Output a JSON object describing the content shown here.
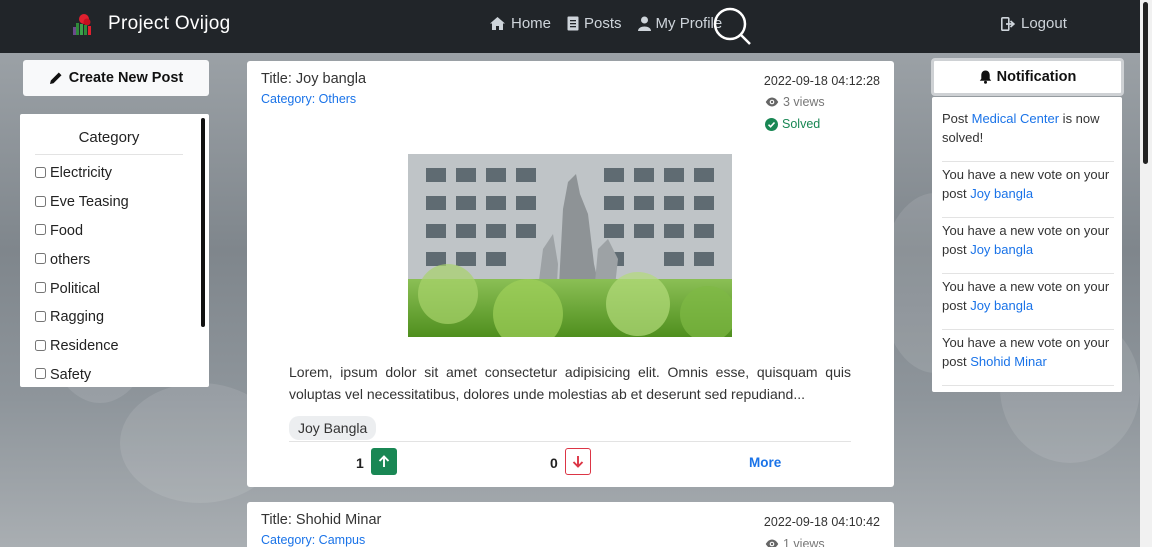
{
  "navbar": {
    "brand": "Project Ovijog",
    "links": [
      {
        "label": "Home",
        "icon": "home-icon"
      },
      {
        "label": "Posts",
        "icon": "file-icon"
      },
      {
        "label": "My Profile",
        "icon": "user-icon"
      }
    ],
    "search_icon": "search-icon",
    "logout": "Logout"
  },
  "sidebar": {
    "create_post": "Create New Post",
    "category_title": "Category",
    "categories": [
      "Electricity",
      "Eve Teasing",
      "Food",
      "others",
      "Political",
      "Ragging",
      "Residence",
      "Safety"
    ]
  },
  "posts": [
    {
      "title": "Title: Joy bangla",
      "category_prefix": "Category: ",
      "category": "Others",
      "date": "2022-09-18 04:12:28",
      "views": "3 views",
      "status": "Solved",
      "body": "Lorem, ipsum dolor sit amet consectetur adipisicing elit. Omnis esse, quisquam quis voluptas vel necessitatibus, dolores unde molestias ab et deserunt sed repudiand...",
      "tag": "Joy Bangla",
      "upvotes": "1",
      "downvotes": "0",
      "more": "More"
    },
    {
      "title": "Title: Shohid Minar",
      "category_prefix": "Category: ",
      "category": "Campus",
      "date": "2022-09-18 04:10:42",
      "views": "1 views"
    }
  ],
  "notifications": {
    "title": "Notification",
    "items": [
      {
        "pre": "Post ",
        "link": "Medical Center",
        "post": " is now solved!"
      },
      {
        "pre": "You have a new vote on your post ",
        "link": "Joy bangla",
        "post": ""
      },
      {
        "pre": "You have a new vote on your post ",
        "link": "Joy bangla",
        "post": ""
      },
      {
        "pre": "You have a new vote on your post ",
        "link": "Joy bangla",
        "post": ""
      },
      {
        "pre": "You have a new vote on your post ",
        "link": "Shohid Minar",
        "post": ""
      }
    ]
  },
  "colors": {
    "navbar": "#212529",
    "link": "#1a73e8",
    "success": "#198754",
    "danger": "#dc3545"
  }
}
